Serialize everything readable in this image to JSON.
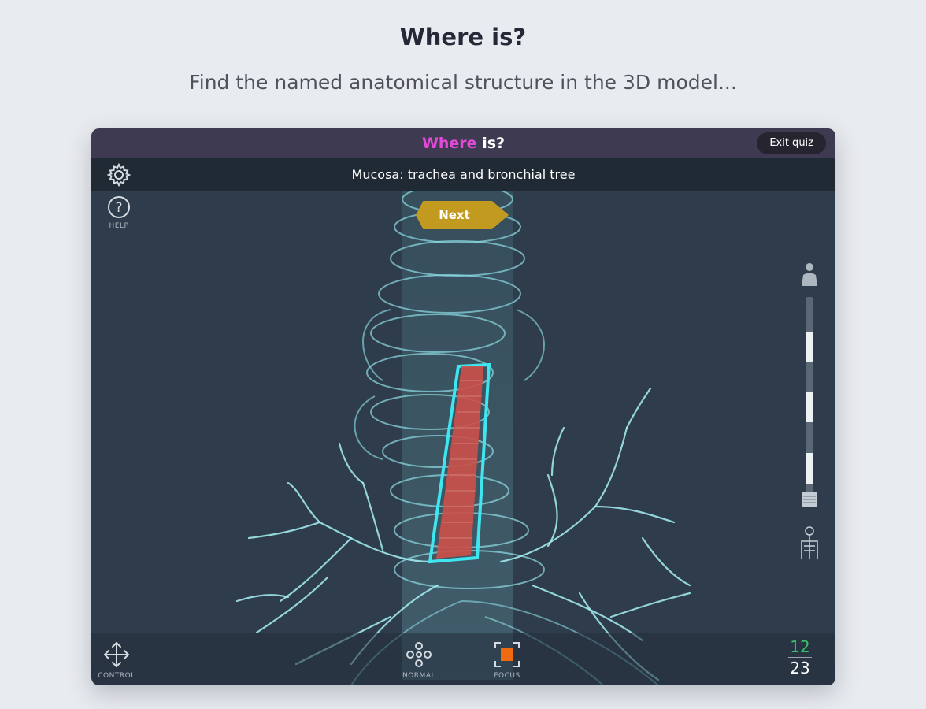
{
  "promo": {
    "title": "Where is?",
    "subtitle": "Find the named anatomical structure in the 3D model..."
  },
  "quiz": {
    "title_accent": "Where",
    "title_rest": " is?",
    "exit_label": "Exit quiz",
    "question": "Mucosa: trachea and bronchial tree",
    "next_label": "Next"
  },
  "sidebar": {
    "settings_icon": "gear-icon",
    "help_icon": "question-circle-icon",
    "help_label": "HELP"
  },
  "layer_slider": {
    "top_icon": "human-body-icon",
    "bottom_icon": "skeleton-icon"
  },
  "toolbar": {
    "control_label": "CONTROL",
    "normal_label": "NORMAL",
    "focus_label": "FOCUS",
    "control_icon": "move-arrows-icon",
    "normal_icon": "nodes-icon",
    "focus_icon": "focus-frame-icon"
  },
  "score": {
    "correct": "12",
    "total": "23"
  },
  "colors": {
    "accent_magenta": "#e04ad6",
    "next_gold": "#c39a20",
    "highlight_cyan": "#3fe6f0",
    "structure_red": "#c9504a",
    "correct_green": "#36c46a",
    "focus_orange": "#ef6a10"
  }
}
